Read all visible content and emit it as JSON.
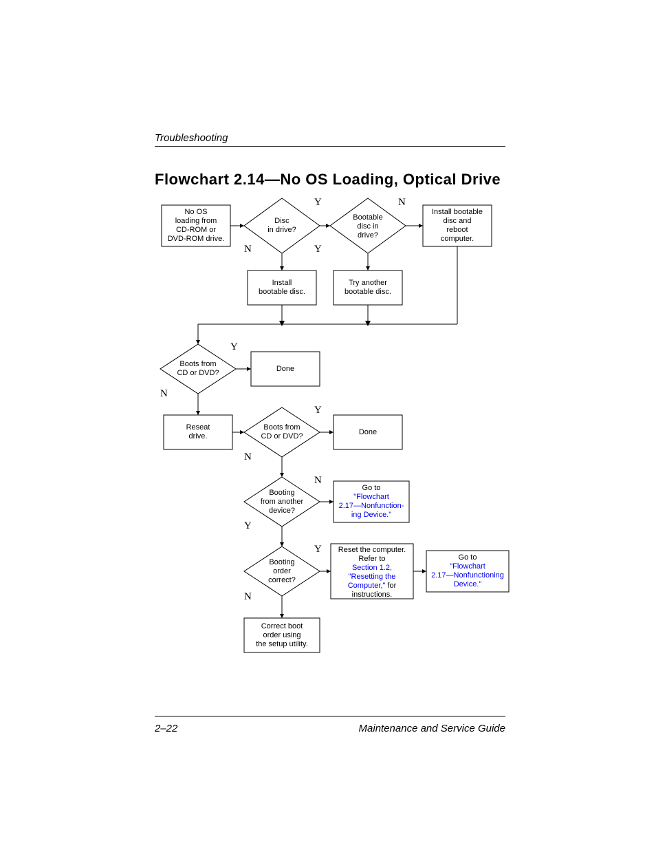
{
  "section": "Troubleshooting",
  "title": "Flowchart 2.14—No OS Loading, Optical Drive",
  "footer_left": "2–22",
  "footer_right": "Maintenance and Service Guide",
  "labels": {
    "Y": "Y",
    "N": "N"
  },
  "nodes": {
    "start": [
      "No OS",
      "loading from",
      "CD-ROM or",
      "DVD-ROM drive."
    ],
    "disc_in": [
      "Disc",
      "in drive?"
    ],
    "boot_disc": [
      "Bootable",
      "disc in",
      "drive?"
    ],
    "install_reboot": [
      "Install bootable",
      "disc and",
      "reboot",
      "computer."
    ],
    "install": [
      "Install",
      "bootable disc."
    ],
    "try_another": [
      "Try another",
      "bootable disc."
    ],
    "boots1": [
      "Boots from",
      "CD or DVD?"
    ],
    "done1": [
      "Done"
    ],
    "reseat": [
      "Reseat",
      "drive."
    ],
    "boots2": [
      "Boots from",
      "CD or DVD?"
    ],
    "done2": [
      "Done"
    ],
    "other": [
      "Booting",
      "from another",
      "device?"
    ],
    "go17a": [
      "Go to",
      "\"Flowchart",
      "2.17—Nonfunction-",
      "ing Device.\""
    ],
    "order": [
      "Booting",
      "order",
      "correct?"
    ],
    "reset": [
      "Reset the computer.",
      "Refer to",
      "Section 1.2,",
      "\"Resetting the",
      "Computer,\"",
      " for",
      "instructions."
    ],
    "go17b": [
      "Go to",
      "\"Flowchart",
      "2.17—Nonfunctioning",
      "Device.\""
    ],
    "correct": [
      "Correct boot",
      "order using",
      "the setup utility."
    ]
  }
}
